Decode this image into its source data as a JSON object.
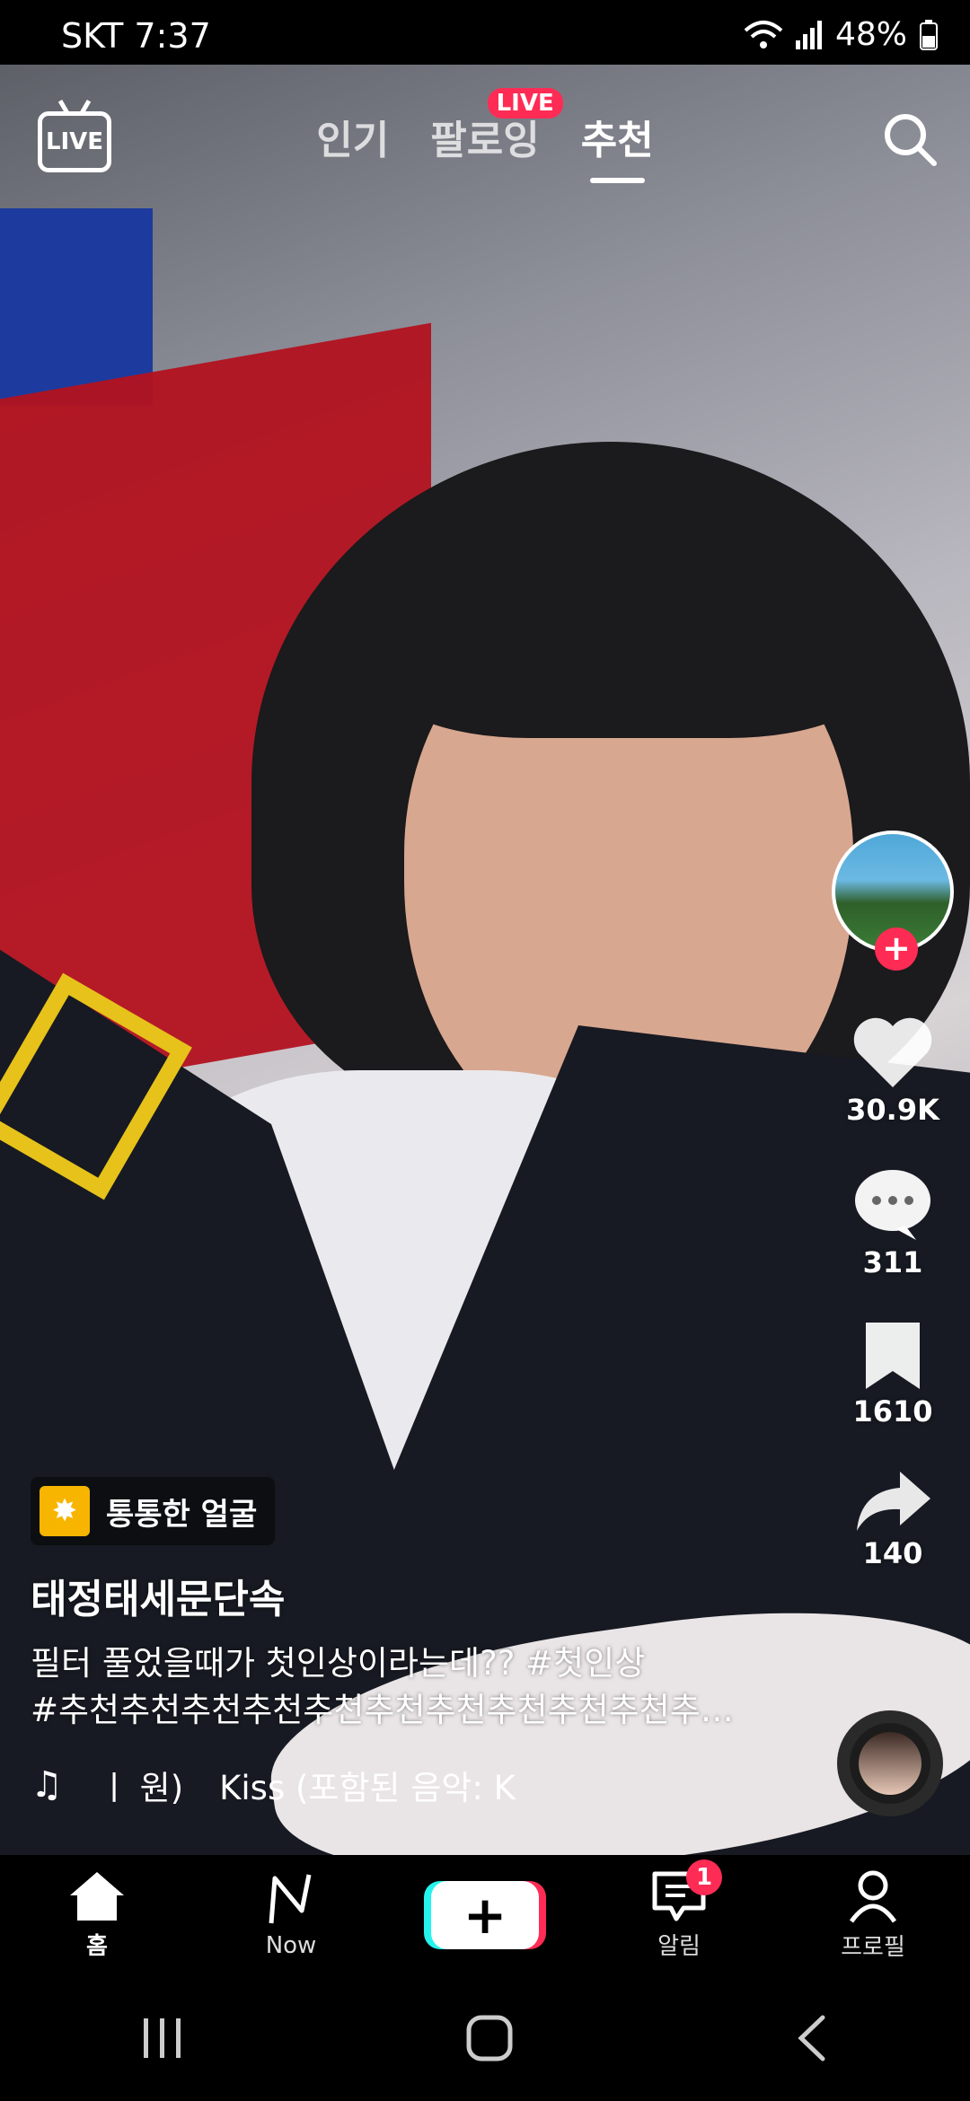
{
  "status_bar": {
    "carrier": "SKT",
    "time": "7:37",
    "battery": "48%"
  },
  "top_nav": {
    "live_icon_label": "LIVE",
    "tabs": [
      {
        "label": "인기",
        "active": false
      },
      {
        "label": "팔로잉",
        "active": false,
        "badge": "LIVE"
      },
      {
        "label": "추천",
        "active": true
      }
    ]
  },
  "side_rail": {
    "likes": "30.9K",
    "comments": "311",
    "bookmarks": "1610",
    "shares": "140"
  },
  "caption": {
    "effect_label": "통통한 얼굴",
    "username": "태정태세문단속",
    "description_line1": "필터 풀었을때가 첫인상이라는데?? #첫인상",
    "description_line2": "#추천추천추천추천추천추천추천추천추천추천추…",
    "music_artist": "ㅣ 원)",
    "music_title": "Kiss (포함된 음악: K"
  },
  "bottom_nav": {
    "home": "홈",
    "now": "Now",
    "inbox": "알림",
    "inbox_badge": "1",
    "profile": "프로필"
  },
  "colors": {
    "accent_pink": "#fe2c55",
    "accent_cyan": "#25f4ee",
    "effect_yellow": "#f7b500"
  }
}
